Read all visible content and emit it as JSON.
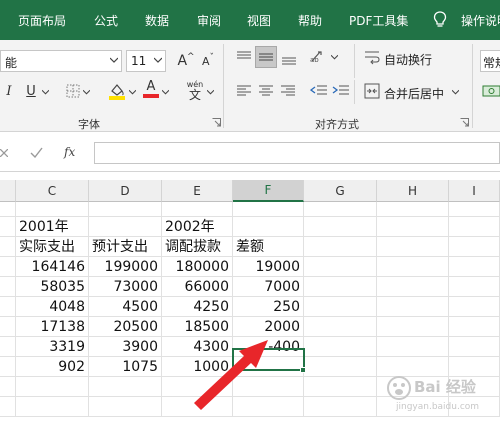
{
  "tabs": [
    "页面布局",
    "公式",
    "数据",
    "审阅",
    "视图",
    "帮助",
    "PDF工具集"
  ],
  "tellme": "操作说明",
  "ribbon": {
    "font_name": "能",
    "font_size": "11",
    "grow": "A",
    "shrink": "A",
    "italic": "I",
    "underline": "U",
    "font_color_a": "A",
    "phonetic_top": "wén",
    "phonetic_bottom": "文",
    "font_group": "字体",
    "wrap_text": "自动换行",
    "merge_center": "合并后居中",
    "align_group": "对齐方式",
    "number_format": "常规",
    "fx": "fx"
  },
  "columns": [
    "C",
    "D",
    "E",
    "F",
    "G",
    "H",
    "I"
  ],
  "rows": [
    [
      "2001年",
      "",
      "2002年",
      ""
    ],
    [
      "实际支出",
      "预计支出",
      "调配拔款",
      "差额"
    ],
    [
      "164146",
      "199000",
      "180000",
      "19000"
    ],
    [
      "58035",
      "73000",
      "66000",
      "7000"
    ],
    [
      "4048",
      "4500",
      "4250",
      "250"
    ],
    [
      "17138",
      "20500",
      "18500",
      "2000"
    ],
    [
      "3319",
      "3900",
      "4300",
      "-400"
    ],
    [
      "902",
      "1075",
      "1000",
      ""
    ]
  ],
  "watermark": {
    "text": "Bai 经验",
    "subtext": "jingyan.baidu.com"
  },
  "colors": {
    "accent": "#217346",
    "arrow": "#e8262a",
    "highlight": "#ffe100",
    "font_red": "#e8262a"
  }
}
